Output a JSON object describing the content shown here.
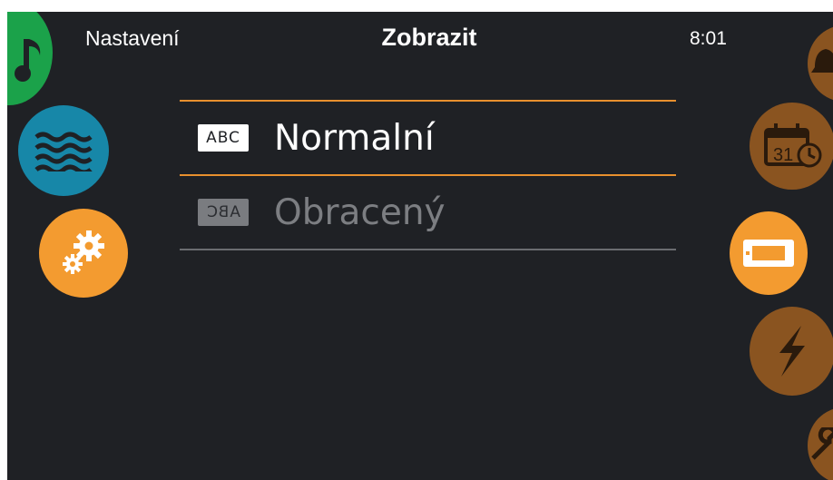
{
  "header": {
    "back_label": "Nastavení",
    "title": "Zobrazit",
    "clock": "8:01"
  },
  "left_menu": [
    {
      "icon": "music-note-icon",
      "color": "#1ba24a"
    },
    {
      "icon": "water-waves-icon",
      "color": "#1787a8"
    },
    {
      "icon": "gears-icon",
      "color": "#f39b30"
    }
  ],
  "right_menu": [
    {
      "icon": "bell-icon",
      "color": "#8a5420"
    },
    {
      "icon": "calendar-clock-icon",
      "color": "#8a5420",
      "badge": "31"
    },
    {
      "icon": "display-icon",
      "color": "#f39b30"
    },
    {
      "icon": "lightning-icon",
      "color": "#8a5420"
    },
    {
      "icon": "wrench-icon",
      "color": "#8a5420"
    }
  ],
  "options": [
    {
      "badge": "ABC",
      "label": "Normalní",
      "selected": true
    },
    {
      "badge": "ABC",
      "label": "Obracený",
      "selected": false
    }
  ],
  "colors": {
    "background": "#1f2125",
    "accent": "#e8902e",
    "text": "#ffffff",
    "muted": "#7c7e82"
  }
}
